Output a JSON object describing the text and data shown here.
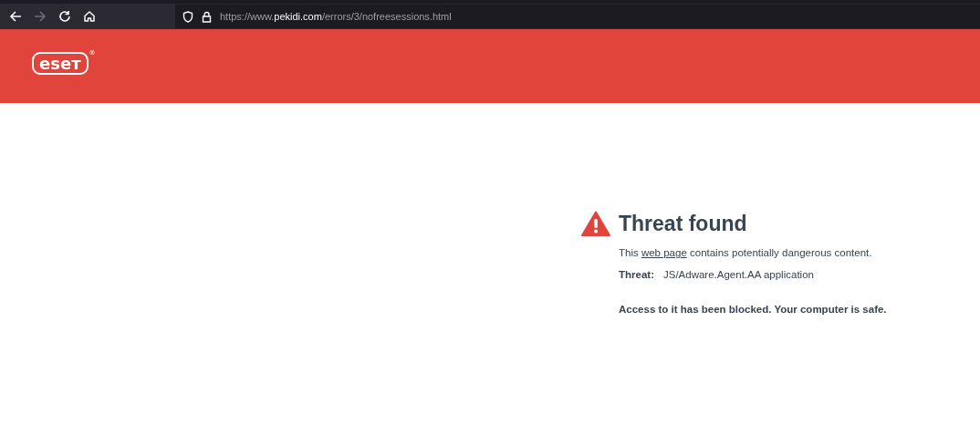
{
  "browser": {
    "back_enabled": true,
    "forward_enabled": false,
    "url": "https://www.**pekidi.com**/errors/3/nofreesessions.html"
  },
  "header": {
    "logo": "eseт",
    "registered": "®"
  },
  "alert": {
    "title": "Threat found",
    "intro_before": "This ",
    "intro_link": "web page",
    "intro_after": " contains potentially dangerous content.",
    "threat_label": "Threat:",
    "threat_value": "JS/Adware.Agent.AA application",
    "conclusion": "Access to it has been blocked. Your computer is safe."
  }
}
